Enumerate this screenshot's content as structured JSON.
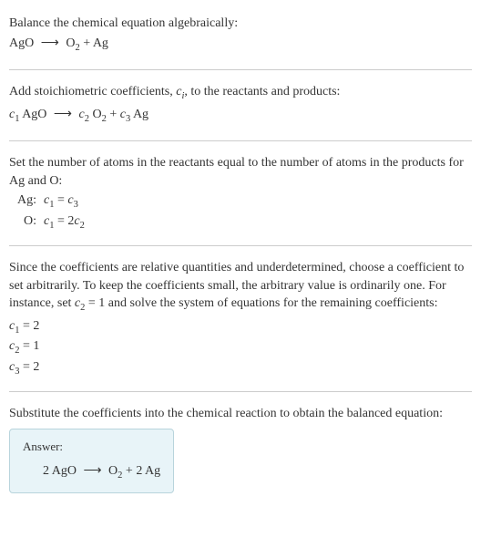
{
  "sec1": {
    "l1": "Balance the chemical equation algebraically:",
    "l2_lhs": "AgO",
    "l2_arrow": "⟶",
    "l2_rhs1": "O",
    "l2_rhs1_sub": "2",
    "l2_plus": " + ",
    "l2_rhs2": "Ag"
  },
  "sec2": {
    "l1a": "Add stoichiometric coefficients, ",
    "l1b": "c",
    "l1c": "i",
    "l1d": ", to the reactants and products:",
    "c1": "c",
    "c1n": "1",
    "r1": " AgO",
    "arrow": "⟶",
    "c2": "c",
    "c2n": "2",
    "r2a": " O",
    "r2s": "2",
    "plus": " + ",
    "c3": "c",
    "c3n": "3",
    "r3": " Ag"
  },
  "sec3": {
    "l1": "Set the number of atoms in the reactants equal to the number of atoms in the products for Ag and O:",
    "row1_label": "Ag:",
    "row1_c1": "c",
    "row1_c1n": "1",
    "row1_eq": " = ",
    "row1_c3": "c",
    "row1_c3n": "3",
    "row2_label": "O:",
    "row2_c1": "c",
    "row2_c1n": "1",
    "row2_eq": " = 2",
    "row2_c2": "c",
    "row2_c2n": "2"
  },
  "sec4": {
    "l1a": "Since the coefficients are relative quantities and underdetermined, choose a coefficient to set arbitrarily. To keep the coefficients small, the arbitrary value is ordinarily one. For instance, set ",
    "l1b": "c",
    "l1c": "2",
    "l1d": " = 1 and solve the system of equations for the remaining coefficients:",
    "v1a": "c",
    "v1b": "1",
    "v1c": " = 2",
    "v2a": "c",
    "v2b": "2",
    "v2c": " = 1",
    "v3a": "c",
    "v3b": "3",
    "v3c": " = 2"
  },
  "sec5": {
    "l1": "Substitute the coefficients into the chemical reaction to obtain the balanced equation:",
    "ans_label": "Answer:",
    "eq_l": "2 AgO",
    "eq_arrow": "⟶",
    "eq_r1": "O",
    "eq_r1s": "2",
    "eq_plus": " + ",
    "eq_r2": "2 Ag"
  }
}
